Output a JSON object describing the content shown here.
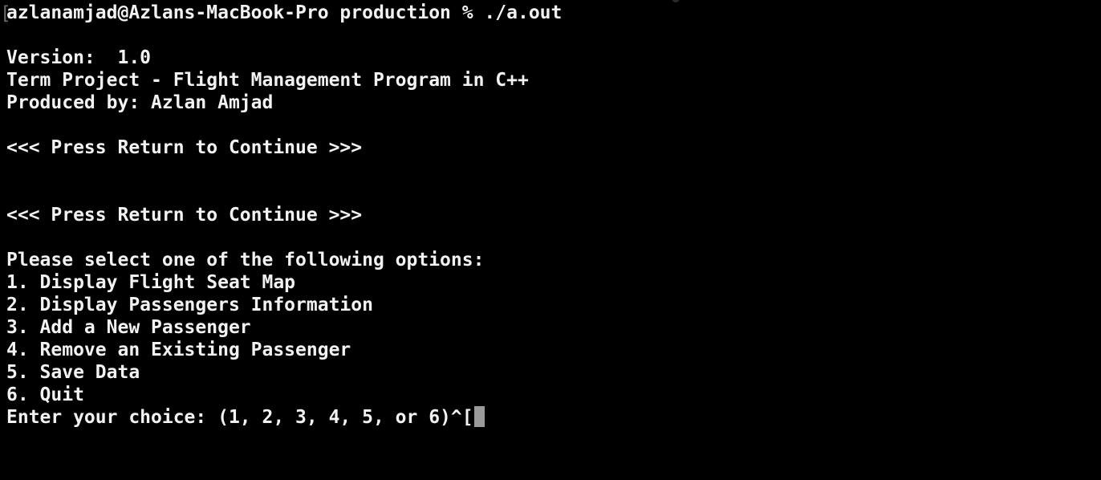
{
  "terminal": {
    "bracket": "[",
    "prompt_line": "azlanamjad@Azlans-MacBook-Pro production % ./a.out",
    "version_line": "Version:  1.0",
    "project_line": "Term Project - Flight Management Program in C++",
    "produced_line": "Produced by: Azlan Amjad",
    "continue_line_1": "<<< Press Return to Continue >>>",
    "continue_line_2": "<<< Press Return to Continue >>>",
    "menu_header": "Please select one of the following options:",
    "menu_items": [
      "1. Display Flight Seat Map",
      "2. Display Passengers Information",
      "3. Add a New Passenger",
      "4. Remove an Existing Passenger",
      "5. Save Data",
      "6. Quit"
    ],
    "choice_prompt": "Enter your choice: (1, 2, 3, 4, 5, or 6)^["
  },
  "colors": {
    "background": "#000000",
    "text": "#f2f2f2",
    "cursor": "#9a9a9a"
  }
}
